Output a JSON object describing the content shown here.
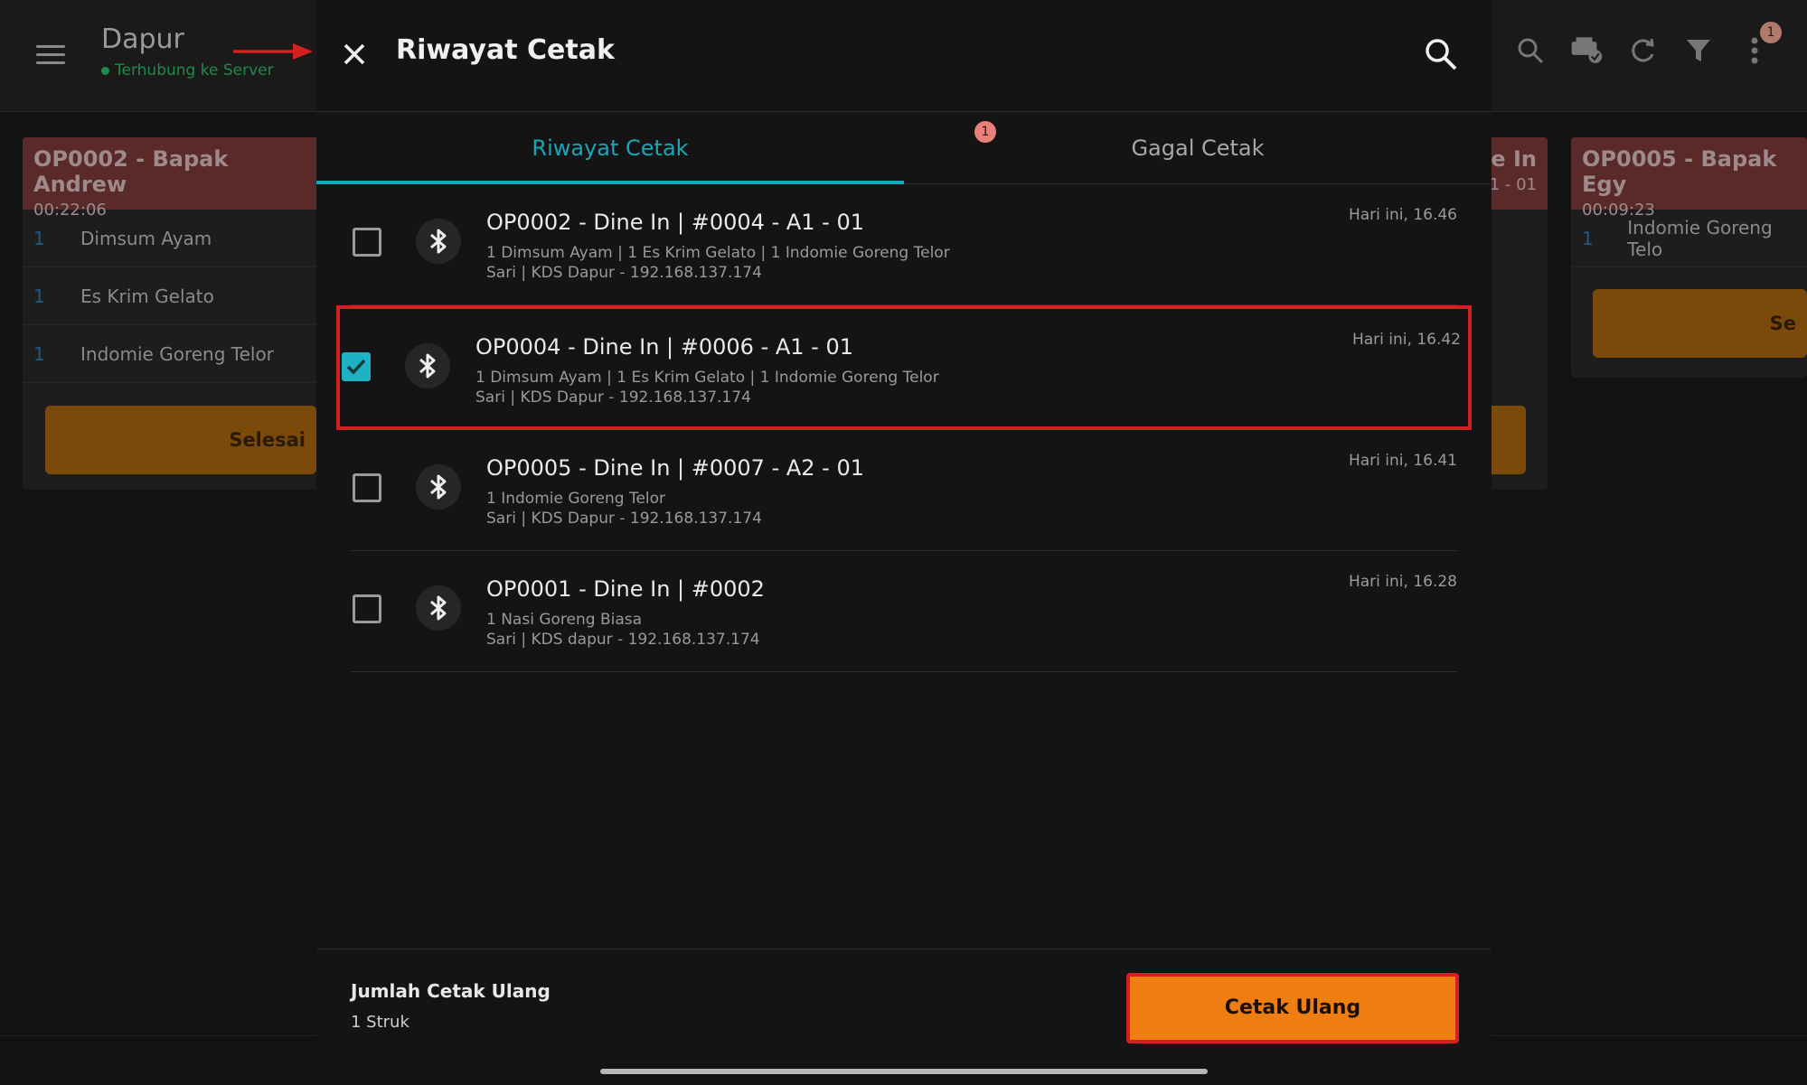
{
  "app": {
    "title": "Dapur",
    "status": "Terhubung ke Server",
    "notification_count": "1"
  },
  "background_orders": [
    {
      "name": "OP0002 - Bapak Andrew",
      "time": "00:22:06",
      "items": [
        {
          "qty": "1",
          "name": "Dimsum Ayam"
        },
        {
          "qty": "1",
          "name": "Es Krim Gelato"
        },
        {
          "qty": "1",
          "name": "Indomie Goreng Telor"
        }
      ],
      "done_label": "Selesai"
    },
    {
      "name": "ne In",
      "time": "1 - 01"
    },
    {
      "name": "OP0005 - Bapak Egy",
      "time": "00:09:23",
      "items": [
        {
          "qty": "1",
          "name": "Indomie Goreng Telo"
        }
      ],
      "done_label": "Se"
    }
  ],
  "dialog": {
    "title": "Riwayat Cetak",
    "tabs": [
      {
        "label": "Riwayat Cetak",
        "active": true
      },
      {
        "label": "Gagal Cetak",
        "active": false,
        "badge": "1"
      }
    ],
    "entries": [
      {
        "title": "OP0002 - Dine In | #0004 - A1 - 01",
        "detail": "1 Dimsum Ayam | 1 Es Krim Gelato | 1 Indomie Goreng Telor",
        "source": "Sari | KDS Dapur - 192.168.137.174",
        "time": "Hari ini, 16.46",
        "checked": false
      },
      {
        "title": "OP0004 - Dine In | #0006 - A1 - 01",
        "detail": "1 Dimsum Ayam | 1 Es Krim Gelato | 1 Indomie Goreng Telor",
        "source": "Sari | KDS Dapur - 192.168.137.174",
        "time": "Hari ini, 16.42",
        "checked": true
      },
      {
        "title": "OP0005 - Dine In | #0007 - A2 - 01",
        "detail": "1 Indomie Goreng Telor",
        "source": "Sari | KDS Dapur - 192.168.137.174",
        "time": "Hari ini, 16.41",
        "checked": false
      },
      {
        "title": "OP0001 - Dine In | #0002",
        "detail": "1 Nasi Goreng Biasa",
        "source": "Sari | KDS dapur - 192.168.137.174",
        "time": "Hari ini, 16.28",
        "checked": false
      }
    ],
    "footer": {
      "label": "Jumlah Cetak Ulang",
      "count": "1 Struk",
      "reprint_label": "Cetak Ulang"
    }
  },
  "colors": {
    "accent": "#19a7b8",
    "reprint": "#ef7e12",
    "highlight": "#d62020"
  }
}
